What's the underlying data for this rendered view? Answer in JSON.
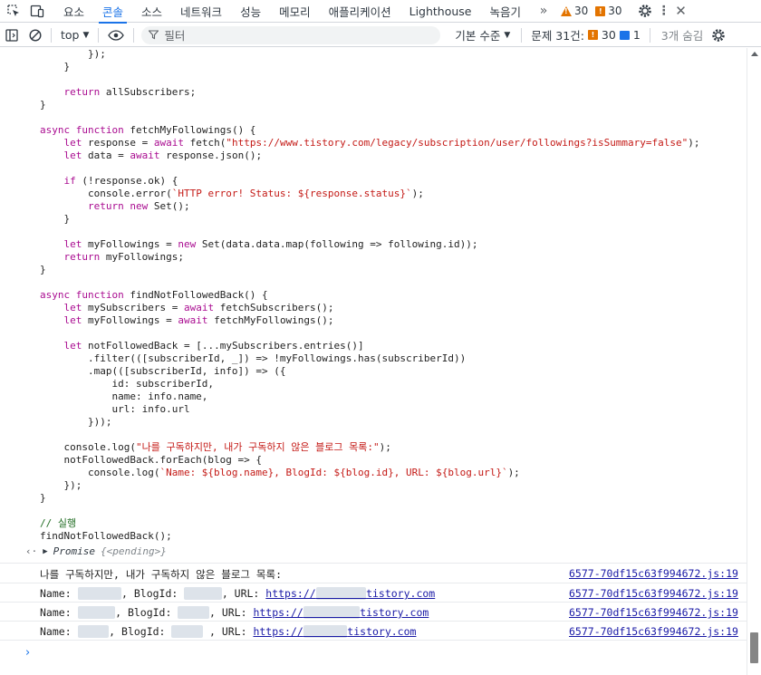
{
  "tabbar": {
    "tabs": [
      "요소",
      "콘솔",
      "소스",
      "네트워크",
      "성능",
      "메모리",
      "애플리케이션",
      "Lighthouse",
      "녹음기"
    ],
    "active_tab": "콘솔",
    "warnings_count": "30",
    "issues_count": "30"
  },
  "toolbar": {
    "context": "top",
    "filter_placeholder": "필터",
    "level": "기본 수준",
    "issues_label": "문제 31건:",
    "issues_warn": "30",
    "issues_info": "1",
    "hidden": "3개 숨김"
  },
  "code_lines": [
    "        });",
    "    }",
    "",
    "    return allSubscribers;",
    "}",
    "",
    "async function fetchMyFollowings() {",
    "    let response = await fetch(\"https://www.tistory.com/legacy/subscription/user/followings?isSummary=false\");",
    "    let data = await response.json();",
    "",
    "    if (!response.ok) {",
    "        console.error(`HTTP error! Status: ${response.status}`);",
    "        return new Set();",
    "    }",
    "",
    "    let myFollowings = new Set(data.data.map(following => following.id));",
    "    return myFollowings;",
    "}",
    "",
    "async function findNotFollowedBack() {",
    "    let mySubscribers = await fetchSubscribers();",
    "    let myFollowings = await fetchMyFollowings();",
    "",
    "    let notFollowedBack = [...mySubscribers.entries()]",
    "        .filter(([subscriberId, _]) => !myFollowings.has(subscriberId))",
    "        .map(([subscriberId, info]) => ({",
    "            id: subscriberId,",
    "            name: info.name,",
    "            url: info.url",
    "        }));",
    "",
    "    console.log(\"나를 구독하지만, 내가 구독하지 않은 블로그 목록:\");",
    "    notFollowedBack.forEach(blog => {",
    "        console.log(`Name: ${blog.name}, BlogId: ${blog.id}, URL: ${blog.url}`);",
    "    });",
    "}",
    "",
    "// 실행",
    "findNotFollowedBack();"
  ],
  "promise": {
    "label": "Promise",
    "state": "{<pending>}"
  },
  "log_rows": [
    {
      "text": "나를 구독하지만, 내가 구독하지 않은 블로그 목록:",
      "source": "6577-70df15c63f994672.js:19"
    },
    {
      "name_label": "Name: ",
      "blogid_label": ", BlogId: ",
      "url_label": ", URL: ",
      "url_prefix": "https://",
      "url_suffix": "tistory.com",
      "source": "6577-70df15c63f994672.js:19"
    },
    {
      "name_label": "Name: ",
      "blogid_label": ", BlogId: ",
      "url_label": ", URL: ",
      "url_prefix": "https://",
      "url_suffix": "tistory.com",
      "source": "6577-70df15c63f994672.js:19"
    },
    {
      "name_label": "Name: ",
      "blogid_label": ", BlogId: ",
      "url_label": " , URL: ",
      "url_prefix": "https://",
      "url_suffix": "tistory.com",
      "source": "6577-70df15c63f994672.js:19"
    }
  ]
}
